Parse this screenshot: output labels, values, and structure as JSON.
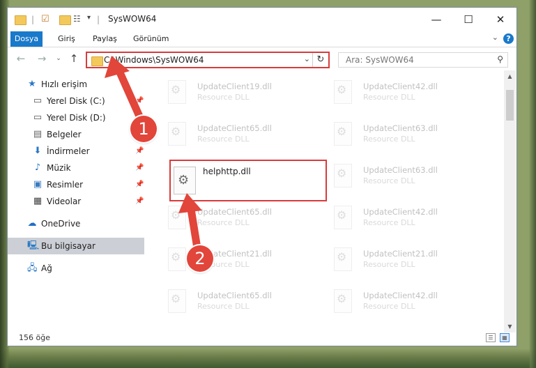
{
  "window": {
    "title": "SysWOW64",
    "controls": {
      "minimize": "—",
      "maximize": "☐",
      "close": "✕"
    }
  },
  "ribbon": {
    "tabs": [
      {
        "label": "Dosya",
        "active": true
      },
      {
        "label": "Giriş"
      },
      {
        "label": "Paylaş"
      },
      {
        "label": "Görünüm"
      }
    ],
    "help": "?"
  },
  "address": {
    "path": "C:\\Windows\\SysWOW64",
    "search_placeholder": "Ara: SysWOW64"
  },
  "sidebar": {
    "items": [
      {
        "label": "Hızlı erişim",
        "icon": "star-icon",
        "pinned": false
      },
      {
        "label": "Yerel Disk (C:)",
        "icon": "drive-icon",
        "pinned": true
      },
      {
        "label": "Yerel Disk (D:)",
        "icon": "drive-icon",
        "pinned": false
      },
      {
        "label": "Belgeler",
        "icon": "document-icon",
        "pinned": false
      },
      {
        "label": "İndirmeler",
        "icon": "download-icon",
        "pinned": true
      },
      {
        "label": "Müzik",
        "icon": "music-icon",
        "pinned": true
      },
      {
        "label": "Resimler",
        "icon": "picture-icon",
        "pinned": true
      },
      {
        "label": "Videolar",
        "icon": "video-icon",
        "pinned": true
      },
      {
        "label": "OneDrive",
        "icon": "cloud-icon",
        "pinned": false
      },
      {
        "label": "Bu bilgisayar",
        "icon": "computer-icon",
        "pinned": false,
        "selected": true
      },
      {
        "label": "Ağ",
        "icon": "network-icon",
        "pinned": false
      }
    ]
  },
  "files": [
    {
      "name": "UpdateClient19.dll",
      "type": "Resource DLL",
      "faded": true
    },
    {
      "name": "UpdateClient42.dll",
      "type": "Resource DLL",
      "faded": true
    },
    {
      "name": "UpdateClient65.dll",
      "type": "Resource DLL",
      "faded": true
    },
    {
      "name": "UpdateClient63.dll",
      "type": "Resource DLL",
      "faded": true
    },
    {
      "name": "helphttp.dll",
      "type": "",
      "faded": false,
      "highlighted": true
    },
    {
      "name": "UpdateClient63.dll",
      "type": "Resource DLL",
      "faded": true
    },
    {
      "name": "UpdateClient65.dll",
      "type": "Resource DLL",
      "faded": true
    },
    {
      "name": "UpdateClient42.dll",
      "type": "Resource DLL",
      "faded": true
    },
    {
      "name": "UpdateClient21.dll",
      "type": "Resource DLL",
      "faded": true
    },
    {
      "name": "UpdateClient21.dll",
      "type": "Resource DLL",
      "faded": true
    },
    {
      "name": "UpdateClient65.dll",
      "type": "Resource DLL",
      "faded": true
    },
    {
      "name": "UpdateClient42.dll",
      "type": "Resource DLL",
      "faded": true
    }
  ],
  "status": {
    "count": "156 öğe"
  },
  "annotations": {
    "step1": "1",
    "step2": "2",
    "color": "#e2453a"
  }
}
